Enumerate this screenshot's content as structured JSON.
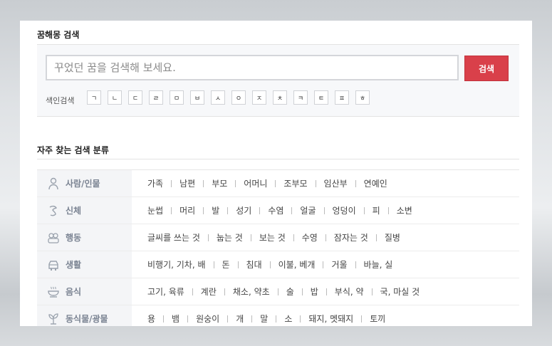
{
  "search_section": {
    "title": "꿈해몽 검색",
    "placeholder": "꾸었던 꿈을 검색해 보세요.",
    "button_label": "검색",
    "index_label": "색인검색",
    "index_keys": [
      "ㄱ",
      "ㄴ",
      "ㄷ",
      "ㄹ",
      "ㅁ",
      "ㅂ",
      "ㅅ",
      "ㅇ",
      "ㅈ",
      "ㅊ",
      "ㅋ",
      "ㅌ",
      "ㅍ",
      "ㅎ"
    ]
  },
  "category_section": {
    "title": "자주 찾는 검색 분류",
    "rows": [
      {
        "icon": "person-icon",
        "label": "사람/인물",
        "items": [
          "가족",
          "남편",
          "부모",
          "어머니",
          "조부모",
          "임산부",
          "연예인"
        ]
      },
      {
        "icon": "body-icon",
        "label": "신체",
        "items": [
          "눈썹",
          "머리",
          "발",
          "성기",
          "수염",
          "얼굴",
          "엉덩이",
          "피",
          "소변"
        ]
      },
      {
        "icon": "people-action-icon",
        "label": "행동",
        "items": [
          "글씨를 쓰는 것",
          "눕는 것",
          "보는 것",
          "수영",
          "잠자는 것",
          "질병"
        ]
      },
      {
        "icon": "car-icon",
        "label": "생활",
        "items": [
          "비행기, 기차, 배",
          "돈",
          "침대",
          "이불, 베개",
          "거울",
          "바늘, 실"
        ]
      },
      {
        "icon": "food-bowl-icon",
        "label": "음식",
        "items": [
          "고기, 육류",
          "계란",
          "채소, 약초",
          "술",
          "밥",
          "부식, 약",
          "국, 마실 것"
        ]
      },
      {
        "icon": "plant-icon",
        "label": "동식물/광물",
        "items": [
          "용",
          "뱀",
          "원숭이",
          "개",
          "말",
          "소",
          "돼지, 멧돼지",
          "토끼"
        ]
      }
    ]
  },
  "colors": {
    "accent": "#d9404a",
    "category_text": "#7a8392",
    "category_bg": "#f4f5f7"
  }
}
